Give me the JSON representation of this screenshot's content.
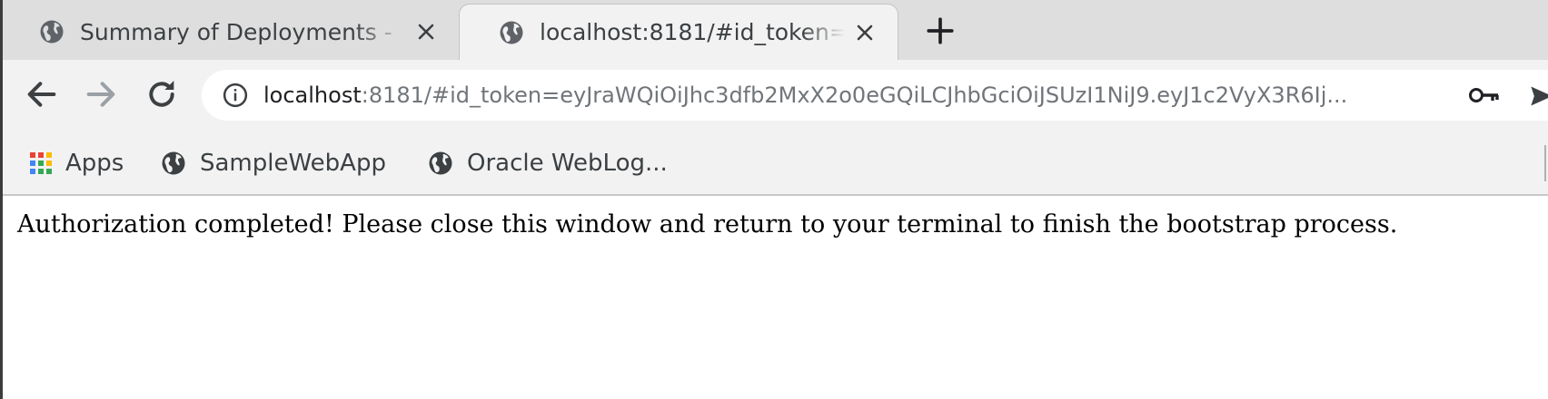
{
  "browser": {
    "tabs": [
      {
        "title": "Summary of Deployments -",
        "favicon": "globe-icon",
        "active": false
      },
      {
        "title": "localhost:8181/#id_token=",
        "favicon": "globe-icon",
        "active": true
      }
    ],
    "new_tab_icon": "plus-icon",
    "toolbar": {
      "back_icon": "arrow-left-icon",
      "forward_icon": "arrow-right-icon",
      "reload_icon": "reload-icon",
      "site_info_icon": "info-icon",
      "url_host": "localhost",
      "url_rest": ":8181/#id_token=eyJraWQiOiJhc3dfb2MxX2o0eGQiLCJhbGciOiJSUzI1NiJ9.eyJ1c2VyX3R6Ij...",
      "password_icon": "key-icon",
      "send_icon": "send-icon"
    },
    "bookmarks": [
      {
        "label": "Apps",
        "icon": "apps-grid-icon"
      },
      {
        "label": "SampleWebApp",
        "icon": "globe-icon"
      },
      {
        "label": "Oracle WebLog...",
        "icon": "globe-icon"
      }
    ]
  },
  "page": {
    "message": "Authorization completed! Please close this window and return to your terminal to finish the bootstrap process."
  },
  "colors": {
    "tabstrip_bg": "#dedede",
    "toolbar_bg": "#f2f2f2",
    "icon_gray": "#5f6368",
    "disabled_gray": "#9aa0a6",
    "text_dark": "#202124",
    "page_bg": "#ffffff"
  }
}
